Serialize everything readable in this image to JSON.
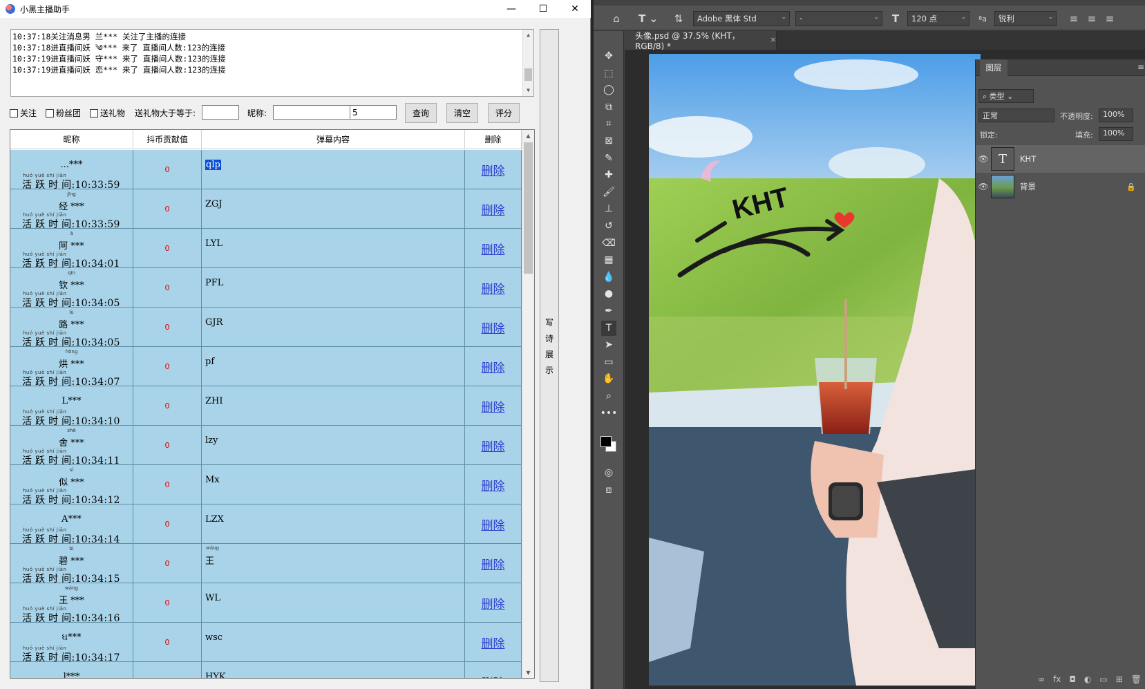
{
  "helper": {
    "title": "小黑主播助手",
    "window_controls": [
      "—",
      "☐",
      "✕"
    ],
    "log_lines": [
      "10:37:18关注消息男  兰*** 关注了主播的连接",
      "10:37:18进直播间妖  ༄*** 来了 直播间人数:123的连接",
      "10:37:19进直播间妖  守*** 来了 直播间人数:123的连接",
      "10:37:19进直播间妖  恋*** 来了 直播间人数:123的连接"
    ],
    "filters": {
      "follow_label": "关注",
      "fans_label": "粉丝团",
      "gift_label": "送礼物",
      "gift_gte_label": "送礼物大于等于:",
      "gift_gte_value": "",
      "nickname_label": "昵称:",
      "nickname_value": "",
      "count_value": "5",
      "query_label": "查询",
      "clear_label": "清空",
      "score_label": "评分"
    },
    "table": {
      "headers": [
        "昵称",
        "抖币贡献值",
        "弹幕内容",
        "删除"
      ],
      "active_pinyin": "huó yuè shí jiān",
      "active_prefix": "活 跃 时 间",
      "rows": [
        {
          "py": "",
          "name": "...***",
          "time": ":10:33:59",
          "coin": "0",
          "danmu": "qlp",
          "danmu_py": "",
          "del": "删除"
        },
        {
          "py": "jīng",
          "name": "经 ***",
          "time": ":10:33:59",
          "coin": "0",
          "danmu": "ZGJ",
          "danmu_py": "",
          "del": "删除"
        },
        {
          "py": "ā",
          "name": "阿 ***",
          "time": ":10:34:01",
          "coin": "0",
          "danmu": "LYL",
          "danmu_py": "",
          "del": "删除"
        },
        {
          "py": "qīn",
          "name": "钦 ***",
          "time": ":10:34:05",
          "coin": "0",
          "danmu": "PFL",
          "danmu_py": "",
          "del": "删除"
        },
        {
          "py": "lù",
          "name": "路 ***",
          "time": ":10:34:05",
          "coin": "0",
          "danmu": "GJR",
          "danmu_py": "",
          "del": "删除"
        },
        {
          "py": "hōng",
          "name": "烘 ***",
          "time": ":10:34:07",
          "coin": "0",
          "danmu": "pf",
          "danmu_py": "",
          "del": "删除"
        },
        {
          "py": "",
          "name": "L***",
          "time": ":10:34:10",
          "coin": "0",
          "danmu": "ZHI",
          "danmu_py": "",
          "del": "删除"
        },
        {
          "py": "shè",
          "name": "舍 ***",
          "time": ":10:34:11",
          "coin": "0",
          "danmu": "lzy",
          "danmu_py": "",
          "del": "删除"
        },
        {
          "py": "sì",
          "name": "似 ***",
          "time": ":10:34:12",
          "coin": "0",
          "danmu": "Mx",
          "danmu_py": "",
          "del": "删除"
        },
        {
          "py": "",
          "name": "A***",
          "time": ":10:34:14",
          "coin": "0",
          "danmu": "LZX",
          "danmu_py": "",
          "del": "删除"
        },
        {
          "py": "bì",
          "name": "碧 ***",
          "time": ":10:34:15",
          "coin": "0",
          "danmu": "王",
          "danmu_py": "wáng",
          "del": "删除"
        },
        {
          "py": "wáng",
          "name": "王 ***",
          "time": ":10:34:16",
          "coin": "0",
          "danmu": "WL",
          "danmu_py": "",
          "del": "删除"
        },
        {
          "py": "",
          "name": "ઘ***",
          "time": ":10:34:17",
          "coin": "0",
          "danmu": "wsc",
          "danmu_py": "",
          "del": "删除"
        },
        {
          "py": "",
          "name": "l***",
          "time": "",
          "coin": "",
          "danmu": "HYK",
          "danmu_py": "",
          "del": "删除"
        }
      ]
    },
    "side_panel_text": [
      "写",
      "诗",
      "展",
      "示"
    ]
  },
  "photoshop": {
    "font_family": "Adobe 黑体 Std",
    "font_style": "-",
    "font_size": "120 点",
    "antialias": "锐利",
    "doc_tab": "头像.psd @ 37.5% (KHT，RGB/8) *",
    "canvas_text": "KHT",
    "layers_panel": {
      "tab": "图层",
      "filter_kind": "类型",
      "blend_mode": "正常",
      "opacity_label": "不透明度:",
      "opacity_value": "100%",
      "lock_label": "锁定:",
      "fill_label": "填充:",
      "fill_value": "100%",
      "layers": [
        {
          "name": "KHT",
          "type": "text"
        },
        {
          "name": "背景",
          "type": "image"
        }
      ]
    }
  }
}
